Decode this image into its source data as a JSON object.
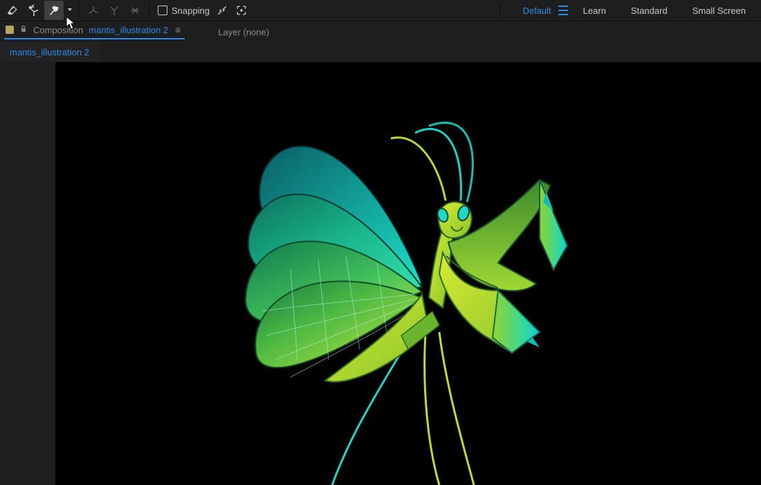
{
  "toolbar": {
    "snapping_label": "Snapping"
  },
  "workspaces": {
    "default": "Default",
    "learn": "Learn",
    "standard": "Standard",
    "small_screen": "Small Screen"
  },
  "panel_header": {
    "composition_label": "Composition",
    "composition_name": "mantis_illustration 2",
    "layer_label": "Layer (none)"
  },
  "subtabs": {
    "first": "mantis_illustration 2"
  }
}
